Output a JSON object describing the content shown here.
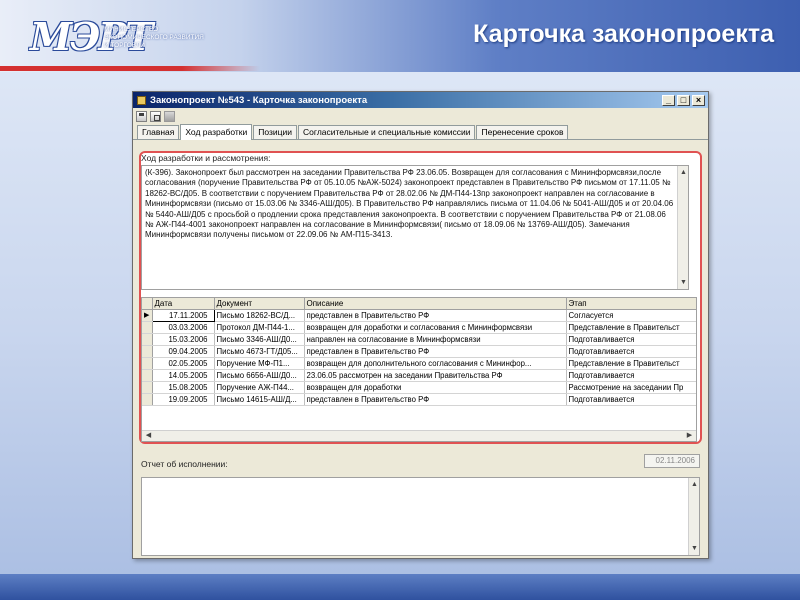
{
  "slide": {
    "title": "Карточка законопроекта",
    "logo_lines": [
      "Министерство",
      "экономического развития",
      "и торговли"
    ]
  },
  "window": {
    "title": "Законопроект №543 - Карточка законопроекта",
    "controls": [
      "_",
      "□",
      "×"
    ]
  },
  "toolbar": {
    "icons": [
      "save-icon",
      "copy-icon",
      "tag-icon"
    ]
  },
  "tabs": [
    {
      "label": "Главная",
      "active": false
    },
    {
      "label": "Ход разработки",
      "active": true
    },
    {
      "label": "Позиции",
      "active": false
    },
    {
      "label": "Согласительные и специальные комиссии",
      "active": false
    },
    {
      "label": "Перенесение сроков",
      "active": false
    }
  ],
  "progress": {
    "label": "Ход разработки и рассмотрения:",
    "text": "(К-396).  Законопроект  был рассмотрен на заседании Правительства РФ 23.06.05. Возвращен для согласования с Мининформсвязи,после  согласования (поручение Правительства РФ от 05.10.05 №АЖ-5024) законопроект представлен в Правительство РФ письмом от 17.11.05 № 18262-ВС/Д05. В соответствии с поручением Правительства РФ от 28.02.06 № ДМ-П44-13пр законопроект направлен  на согласование в Мининформсвязи (письмо от 15.03.06 № 3346-АШ/Д05). В Правительство РФ  направлялись  письма  от 11.04.06 № 5041-АШ/Д05 и от 20.04.06 № 5440-АШ/Д05 с  просьбой о продлении срока представления законопроекта. В соответствии с поручением Правительства РФ от 21.08.06 № АЖ-П44-4001 законопроект  направлен на согласование в Мининформсвязи( письмо от 18.09.06  № 13769-АШ/Д05). Замечания Мининформсвязи получены письмом от 22.09.06 № АМ-П15-3413."
  },
  "table": {
    "columns": [
      "Дата",
      "Документ",
      "Описание",
      "Этап"
    ],
    "rows": [
      {
        "date": "17.11.2005",
        "document": "Письмо 18262-ВС/Д...",
        "description": "представлен в Правительство РФ",
        "stage": "Согласуется",
        "selected": true
      },
      {
        "date": "03.03.2006",
        "document": "Протокол ДМ-П44-1...",
        "description": "возвращен для доработки и согласования с Мининформсвязи",
        "stage": "Представление в Правительст",
        "selected": false
      },
      {
        "date": "15.03.2006",
        "document": "Письмо 3346-АШ/Д0...",
        "description": "направлен на согласование в Мининформсвязи",
        "stage": "Подготавливается",
        "selected": false
      },
      {
        "date": "09.04.2005",
        "document": "Письмо 4673-ГТ/Д05...",
        "description": "представлен в Правительство РФ",
        "stage": "Подготавливается",
        "selected": false
      },
      {
        "date": "02.05.2005",
        "document": "Поручение МФ-П1...",
        "description": "возвращен для дополнительного согласования с Мининфор...",
        "stage": "Представление в Правительст",
        "selected": false
      },
      {
        "date": "14.05.2005",
        "document": "Письмо 6656-АШ/Д0...",
        "description": "23.06.05 рассмотрен на заседании Правительства РФ",
        "stage": "Подготавливается",
        "selected": false
      },
      {
        "date": "15.08.2005",
        "document": "Поручение АЖ-П44...",
        "description": "возвращен для доработки",
        "stage": "Рассмотрение на заседании Пр",
        "selected": false
      },
      {
        "date": "19.09.2005",
        "document": "Письмо 14615-АШ/Д...",
        "description": "представлен в Правительство РФ",
        "stage": "Подготавливается",
        "selected": false
      }
    ]
  },
  "report": {
    "label": "Отчет об исполнении:",
    "date": "02.11.2006"
  }
}
